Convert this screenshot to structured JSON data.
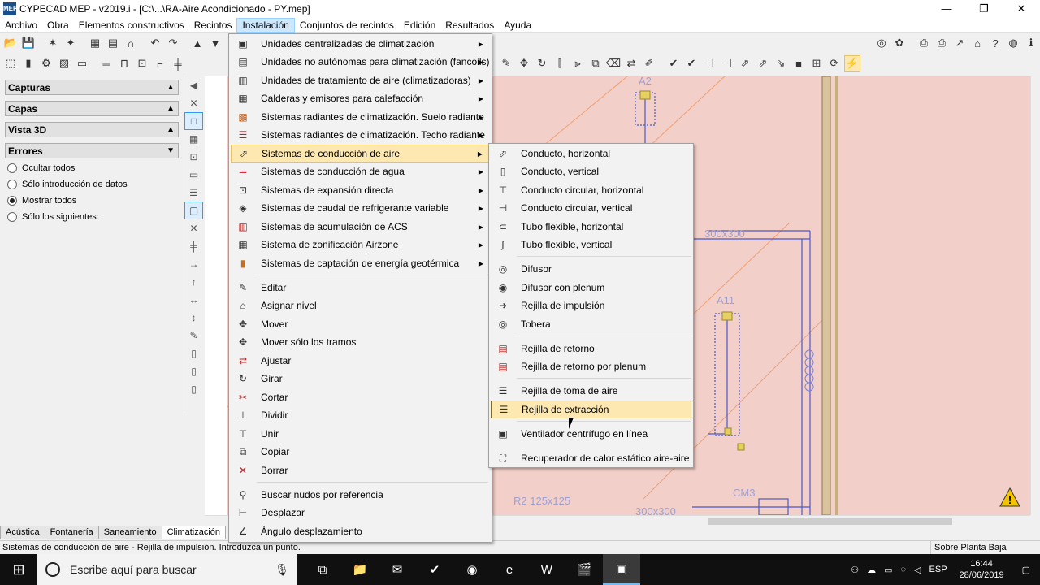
{
  "window": {
    "title": "CYPECAD MEP - v2019.i - [C:\\...\\RA-Aire Acondicionado - PY.mep]",
    "minimize": "—",
    "maximize": "❐",
    "close": "✕"
  },
  "menubar": [
    "Archivo",
    "Obra",
    "Elementos constructivos",
    "Recintos",
    "Instalación",
    "Conjuntos de recintos",
    "Edición",
    "Resultados",
    "Ayuda"
  ],
  "left_panel": {
    "sections": [
      "Capturas",
      "Capas",
      "Vista 3D",
      "Errores"
    ],
    "options": [
      {
        "label": "Ocultar todos",
        "selected": false
      },
      {
        "label": "Sólo introducción de datos",
        "selected": false
      },
      {
        "label": "Mostrar todos",
        "selected": true
      },
      {
        "label": "Sólo los siguientes:",
        "selected": false
      }
    ]
  },
  "menu": {
    "items": [
      {
        "label": "Unidades centralizadas de climatización",
        "icon": "hvac-unit-icon",
        "submenu": true
      },
      {
        "label": "Unidades no autónomas para climatización (fancoils)",
        "icon": "fancoil-icon",
        "submenu": true
      },
      {
        "label": "Unidades de tratamiento de aire (climatizadoras)",
        "icon": "air-handler-icon",
        "submenu": true
      },
      {
        "label": "Calderas y emisores para calefacción",
        "icon": "boiler-icon",
        "submenu": true
      },
      {
        "label": "Sistemas radiantes de climatización. Suelo radiante",
        "icon": "radiant-floor-icon",
        "submenu": true
      },
      {
        "label": "Sistemas radiantes de climatización. Techo radiante",
        "icon": "radiant-ceiling-icon",
        "submenu": true
      },
      {
        "label": "Sistemas de conducción de aire",
        "icon": "air-duct-icon",
        "submenu": true,
        "highlighted": true
      },
      {
        "label": "Sistemas de conducción de agua",
        "icon": "water-pipe-icon",
        "submenu": true
      },
      {
        "label": "Sistemas de expansión directa",
        "icon": "direct-expansion-icon",
        "submenu": true
      },
      {
        "label": "Sistemas de caudal de refrigerante variable",
        "icon": "vrf-icon",
        "submenu": true
      },
      {
        "label": "Sistemas de acumulación de ACS",
        "icon": "dhw-tank-icon",
        "submenu": true
      },
      {
        "label": "Sistema de zonificación Airzone",
        "icon": "airzone-icon",
        "submenu": true
      },
      {
        "label": "Sistemas de captación de energía geotérmica",
        "icon": "geothermal-icon",
        "submenu": true
      },
      {
        "label": "Editar",
        "icon": "edit-icon"
      },
      {
        "label": "Asignar nivel",
        "icon": "level-icon"
      },
      {
        "label": "Mover",
        "icon": "move-icon"
      },
      {
        "label": "Mover sólo los tramos",
        "icon": "move-segments-icon"
      },
      {
        "label": "Ajustar",
        "icon": "adjust-icon"
      },
      {
        "label": "Girar",
        "icon": "rotate-icon"
      },
      {
        "label": "Cortar",
        "icon": "cut-icon"
      },
      {
        "label": "Dividir",
        "icon": "split-icon"
      },
      {
        "label": "Unir",
        "icon": "join-icon"
      },
      {
        "label": "Copiar",
        "icon": "copy-icon"
      },
      {
        "label": "Borrar",
        "icon": "delete-icon"
      },
      {
        "label": "Buscar nudos por referencia",
        "icon": "find-node-icon"
      },
      {
        "label": "Desplazar",
        "icon": "displace-icon"
      },
      {
        "label": "Ángulo desplazamiento",
        "icon": "angle-icon"
      }
    ]
  },
  "submenu": {
    "items": [
      {
        "label": "Conducto, horizontal",
        "icon": "duct-horizontal-icon"
      },
      {
        "label": "Conducto, vertical",
        "icon": "duct-vertical-icon"
      },
      {
        "label": "Conducto circular, horizontal",
        "icon": "circular-duct-horizontal-icon"
      },
      {
        "label": "Conducto circular, vertical",
        "icon": "circular-duct-vertical-icon"
      },
      {
        "label": "Tubo flexible, horizontal",
        "icon": "flex-tube-horizontal-icon"
      },
      {
        "label": "Tubo flexible, vertical",
        "icon": "flex-tube-vertical-icon"
      },
      {
        "label": "Difusor",
        "icon": "diffuser-icon"
      },
      {
        "label": "Difusor con plenum",
        "icon": "diffuser-plenum-icon"
      },
      {
        "label": "Rejilla de impulsión",
        "icon": "supply-grille-icon"
      },
      {
        "label": "Tobera",
        "icon": "nozzle-icon"
      },
      {
        "label": "Rejilla de retorno",
        "icon": "return-grille-icon"
      },
      {
        "label": "Rejilla de retorno por plenum",
        "icon": "return-plenum-grille-icon"
      },
      {
        "label": "Rejilla de toma de aire",
        "icon": "intake-grille-icon"
      },
      {
        "label": "Rejilla de extracción",
        "icon": "extraction-grille-icon",
        "highlighted": true
      },
      {
        "label": "Ventilador centrífugo en línea",
        "icon": "inline-fan-icon"
      },
      {
        "label": "Recuperador de calor estático aire-aire",
        "icon": "heat-recovery-icon"
      }
    ]
  },
  "canvas": {
    "labels": [
      "A2",
      "A11",
      "300x300",
      "CM3",
      "R2 125x125",
      "300x300"
    ]
  },
  "bottom_tabs": [
    "Acústica",
    "Fontanería",
    "Saneamiento",
    "Climatización"
  ],
  "status": {
    "message": "Sistemas de conducción de aire - Rejilla de impulsión. Introduzca un punto.",
    "level": "Sobre Planta Baja"
  },
  "taskbar": {
    "search_placeholder": "Escribe aquí para buscar",
    "language": "ESP",
    "time": "16:44",
    "date": "28/06/2019"
  },
  "colors": {
    "canvas": "#f3cfc9",
    "highlight": "#fce8b0"
  }
}
